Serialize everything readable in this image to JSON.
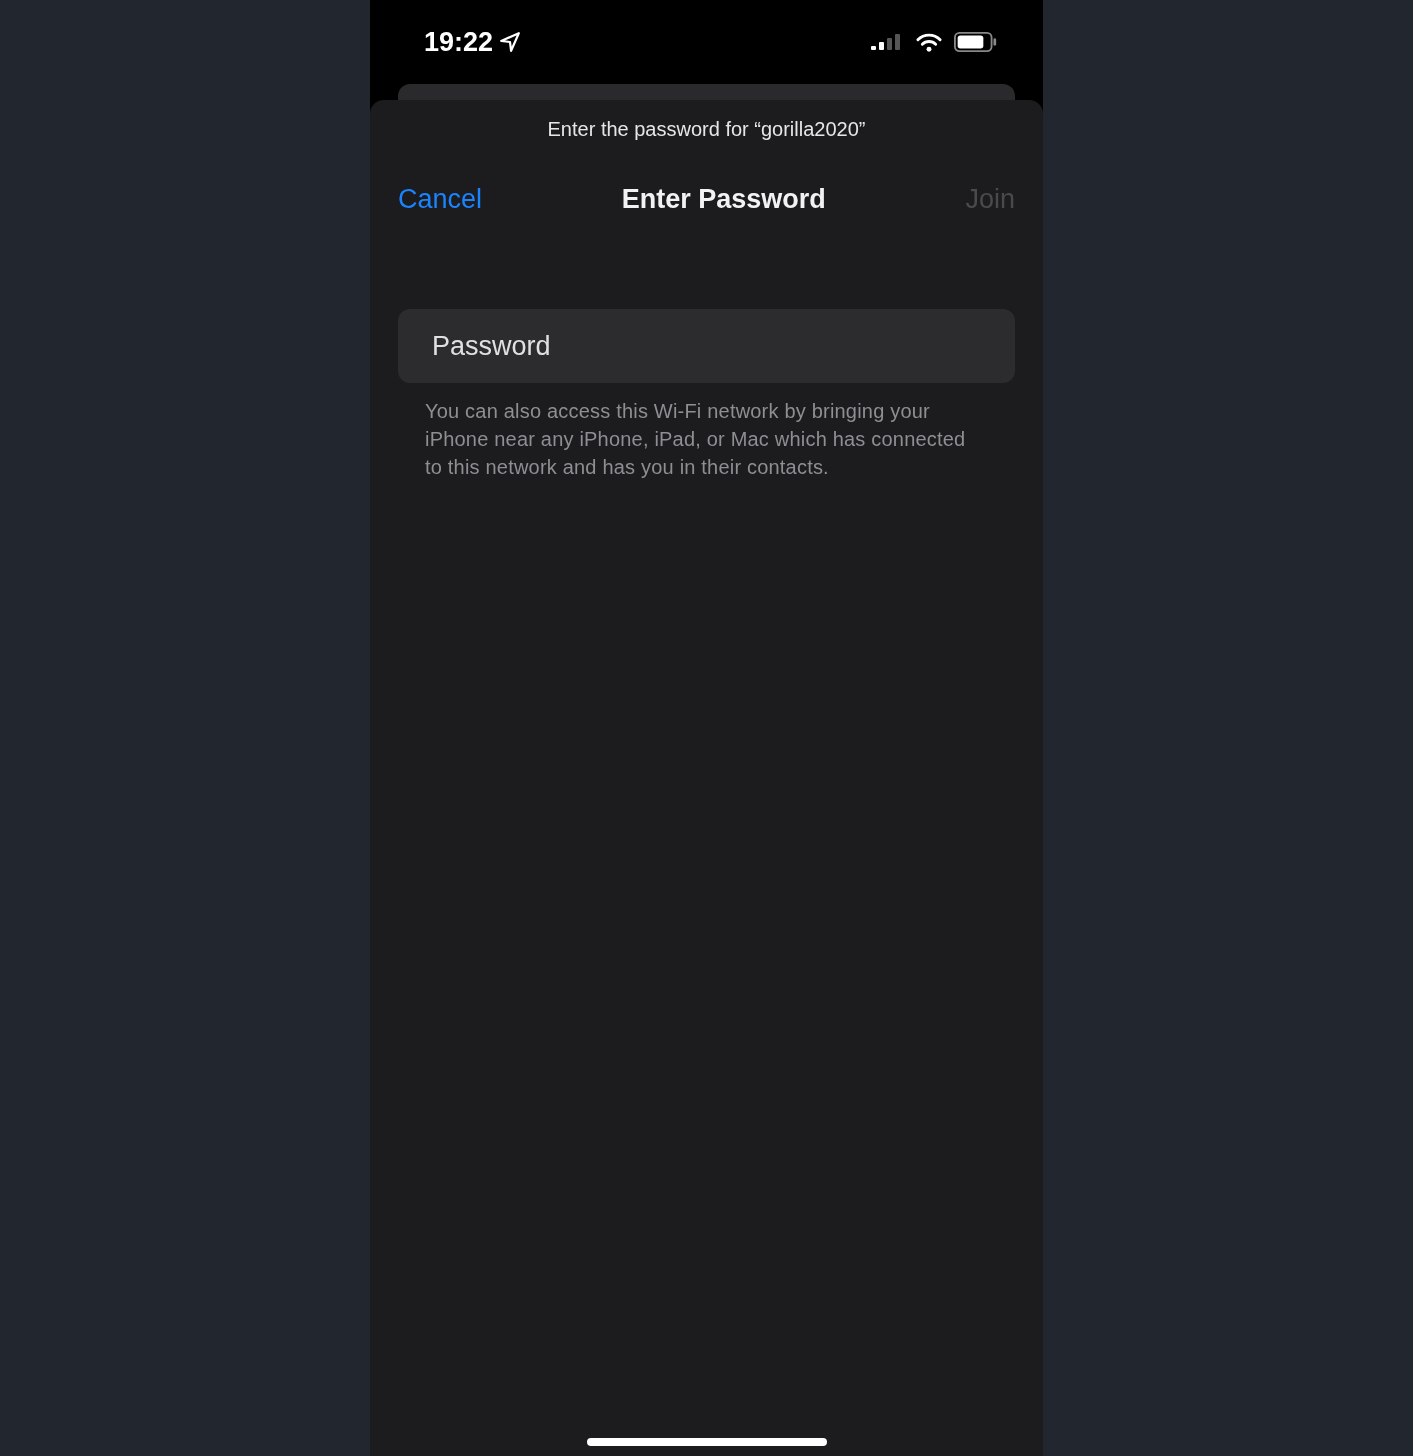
{
  "status_bar": {
    "time": "19:22",
    "location_on": true
  },
  "sheet": {
    "subtitle": "Enter the password for “gorilla2020”",
    "cancel": {
      "label": "Cancel"
    },
    "title": "Enter Password",
    "join": {
      "label": "Join",
      "disabled": true
    },
    "password_field": {
      "placeholder": "Password"
    },
    "footnote": "You can also access this Wi-Fi network by bringing your iPhone near any iPhone, iPad, or Mac which has connected to this network and has you in their contacts."
  }
}
